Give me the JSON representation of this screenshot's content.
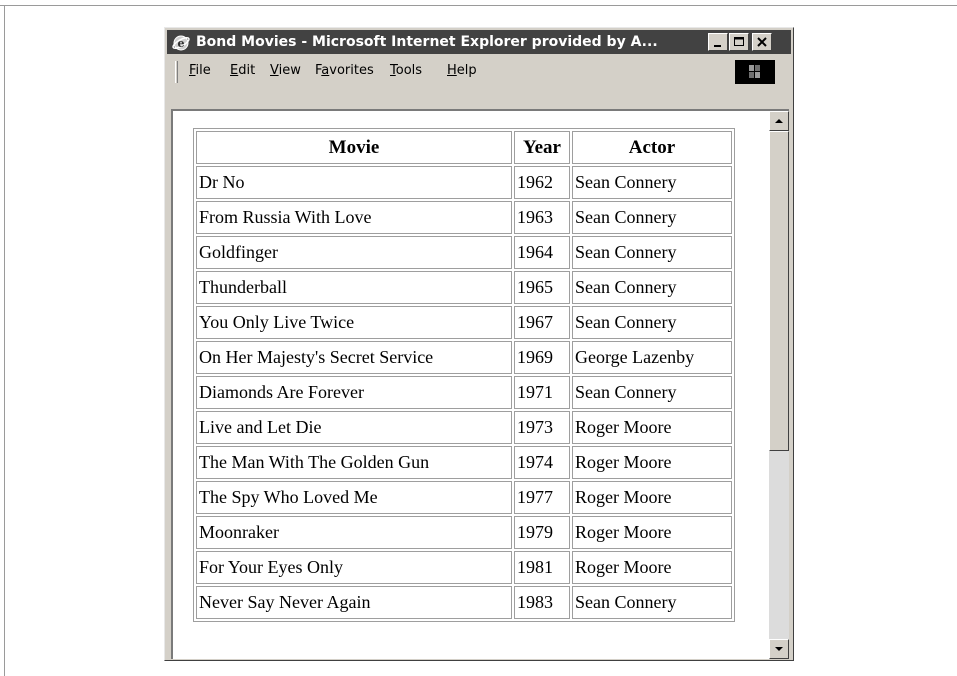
{
  "window": {
    "title": "Bond Movies - Microsoft Internet Explorer provided by A..."
  },
  "menu": [
    {
      "label": "File",
      "mnemonic_index": 0
    },
    {
      "label": "Edit",
      "mnemonic_index": 0
    },
    {
      "label": "View",
      "mnemonic_index": 0
    },
    {
      "label": "Favorites",
      "mnemonic_index": 1
    },
    {
      "label": "Tools",
      "mnemonic_index": 0
    },
    {
      "label": "Help",
      "mnemonic_index": 0
    }
  ],
  "table": {
    "headers": [
      "Movie",
      "Year",
      "Actor"
    ],
    "rows": [
      [
        "Dr No",
        "1962",
        "Sean Connery"
      ],
      [
        "From Russia With Love",
        "1963",
        "Sean Connery"
      ],
      [
        "Goldfinger",
        "1964",
        "Sean Connery"
      ],
      [
        "Thunderball",
        "1965",
        "Sean Connery"
      ],
      [
        "You Only Live Twice",
        "1967",
        "Sean Connery"
      ],
      [
        "On Her Majesty's Secret Service",
        "1969",
        "George Lazenby"
      ],
      [
        "Diamonds Are Forever",
        "1971",
        "Sean Connery"
      ],
      [
        "Live and Let Die",
        "1973",
        "Roger Moore"
      ],
      [
        "The Man With The Golden Gun",
        "1974",
        "Roger Moore"
      ],
      [
        "The Spy Who Loved Me",
        "1977",
        "Roger Moore"
      ],
      [
        "Moonraker",
        "1979",
        "Roger Moore"
      ],
      [
        "For Your Eyes Only",
        "1981",
        "Roger Moore"
      ],
      [
        "Never Say Never Again",
        "1983",
        "Sean Connery"
      ]
    ]
  },
  "icons": {
    "app": "ie-globe-icon",
    "throbber": "windows-logo-icon",
    "minimize": "minimize-icon",
    "maximize": "maximize-icon",
    "close": "close-icon",
    "scroll_up": "arrow-up-icon",
    "scroll_down": "arrow-down-icon"
  },
  "colors": {
    "titlebar": "#424242",
    "chrome": "#d4d0c8"
  }
}
